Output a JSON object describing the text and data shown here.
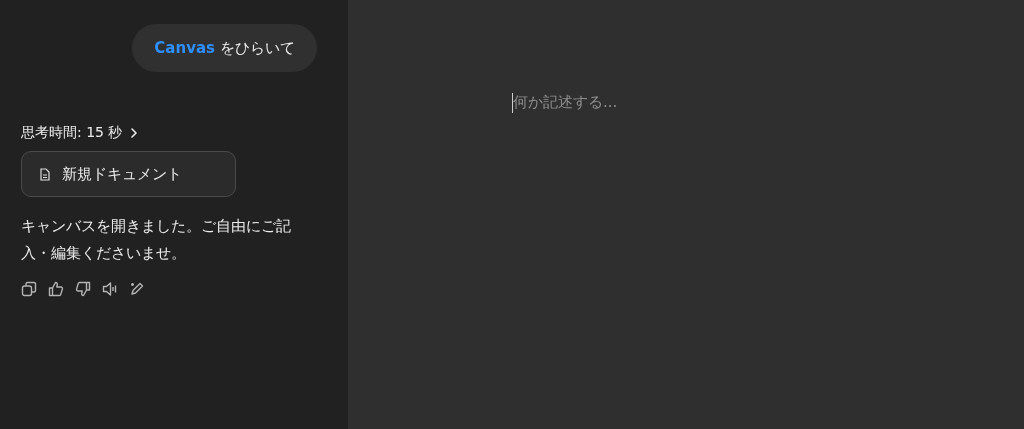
{
  "user_message": {
    "mention": "Canvas",
    "text": "をひらいて"
  },
  "thinking": {
    "label": "思考時間: 15 秒",
    "expanded": false
  },
  "document_button": {
    "label": "新規ドキュメント"
  },
  "reply": "キャンバスを開きました。ご自由にご記入・編集くださいませ。",
  "editor": {
    "placeholder": "何か記述する..."
  }
}
